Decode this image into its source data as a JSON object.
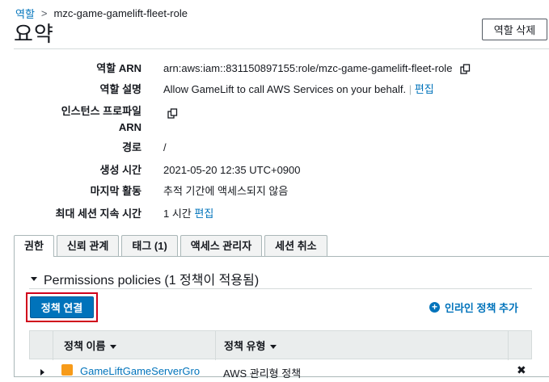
{
  "breadcrumb": {
    "parent": "역할",
    "separator": ">",
    "current": "mzc-game-gamelift-fleet-role"
  },
  "page": {
    "title": "요약",
    "delete_button": "역할 삭제"
  },
  "summary": {
    "role_arn": {
      "label": "역할 ARN",
      "value": "arn:aws:iam::831150897155:role/mzc-game-gamelift-fleet-role"
    },
    "description": {
      "label": "역할 설명",
      "value": "Allow GameLift to call AWS Services on your behalf.",
      "separator": "|",
      "edit": "편집"
    },
    "instance_profile": {
      "label_line1": "인스턴스 프로파일",
      "label_line2": "ARN"
    },
    "path": {
      "label": "경로",
      "value": "/"
    },
    "created": {
      "label": "생성 시간",
      "value": "2021-05-20 12:35 UTC+0900"
    },
    "last_activity": {
      "label": "마지막 활동",
      "value": "추적 기간에 액세스되지 않음"
    },
    "max_session": {
      "label": "최대 세션 지속 시간",
      "value": "1 시간",
      "edit": "편집"
    }
  },
  "tabs": [
    {
      "label": "권한",
      "active": true
    },
    {
      "label": "신뢰 관계",
      "active": false
    },
    {
      "label": "태그 (1)",
      "active": false
    },
    {
      "label": "액세스 관리자",
      "active": false
    },
    {
      "label": "세션 취소",
      "active": false
    }
  ],
  "permissions": {
    "section_title": "Permissions policies (1 정책이 적용됨)",
    "attach_button": "정책 연결",
    "add_inline": "인라인 정책 추가",
    "table": {
      "headers": [
        "정책 이름",
        "정책 유형"
      ],
      "rows": [
        {
          "name": "GameLiftGameServerGro",
          "type": "AWS 관리형 정책"
        }
      ]
    }
  },
  "colors": {
    "link": "#0073bb",
    "primary_button": "#0073bb",
    "highlight_border": "#d0021b",
    "policy_icon": "#f79b1a"
  },
  "icons": {
    "copy": "copy-icon",
    "plus": "plus-circle-icon",
    "remove": "close-icon",
    "policy": "policy-box-icon"
  }
}
